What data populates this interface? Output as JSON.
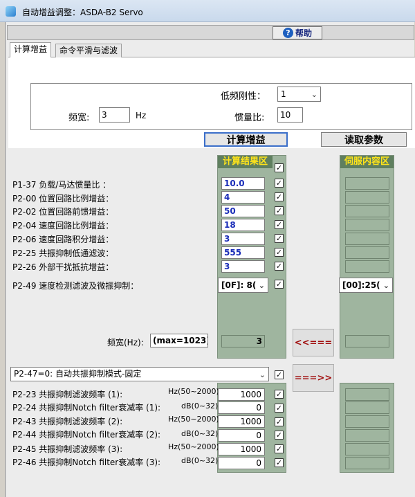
{
  "window": {
    "title": "自动增益调整：ASDA-B2 Servo"
  },
  "toolbar": {
    "help_label": "帮助",
    "help_icon": "?"
  },
  "tabs": [
    {
      "label": "计算增益",
      "active": true
    },
    {
      "label": "命令平滑与滤波",
      "active": false
    }
  ],
  "calc": {
    "stiffness_label": "低频刚性：",
    "stiffness_value": "1",
    "bandwidth_label": "频宽:",
    "bandwidth_value": "3",
    "bandwidth_unit": "Hz",
    "inertia_label": "惯量比:",
    "inertia_value": "10",
    "calc_button": "计算增益",
    "read_button": "读取参数"
  },
  "columns": {
    "calc_header": "计算结果区",
    "servo_header": "伺服内容区"
  },
  "params": [
    {
      "label": "P1-37 负载/马达惯量比 ：",
      "value": "10.0"
    },
    {
      "label": "P2-00 位置回路比例增益：",
      "value": "4"
    },
    {
      "label": "P2-02 位置回路前馈增益：",
      "value": "50"
    },
    {
      "label": "P2-04 速度回路比例增益：",
      "value": "18"
    },
    {
      "label": "P2-06 速度回路积分增益：",
      "value": "3"
    },
    {
      "label": "P2-25 共振抑制低通滤波：",
      "value": "555"
    },
    {
      "label": "P2-26 外部干扰抵抗增益：",
      "value": "3"
    }
  ],
  "p249": {
    "label": "P2-49 速度检测滤波及微振抑制：",
    "calc_value": "[0F]: 8(",
    "servo_value": "[00]:25("
  },
  "freq": {
    "label": "频宽(Hz):",
    "max_label": "(max=1023)",
    "value": "3"
  },
  "arrows": {
    "left": "<<===",
    "right": "===>>"
  },
  "p247": {
    "value": "P2-47=0: 自动共振抑制模式-固定"
  },
  "resonance": [
    {
      "label": "P2-23 共振抑制滤波频率 (1):",
      "unit": "Hz(50~2000)",
      "value": "1000"
    },
    {
      "label": "P2-24 共振抑制Notch filter衰减率 (1):",
      "unit": "dB(0~32)",
      "value": "0"
    },
    {
      "label": "P2-43 共振抑制滤波频率 (2):",
      "unit": "Hz(50~2000)",
      "value": "1000"
    },
    {
      "label": "P2-44 共振抑制Notch filter衰减率 (2):",
      "unit": "dB(0~32)",
      "value": "0"
    },
    {
      "label": "P2-45 共振抑制滤波频率 (3):",
      "unit": "Hz(50~2000)",
      "value": "1000"
    },
    {
      "label": "P2-46 共振抑制Notch filter衰减率 (3):",
      "unit": "dB(0~32)",
      "value": "0"
    }
  ],
  "colors": {
    "green": "#9fb59f",
    "header_bg": "#5f7f5f",
    "header_text": "#ffe41a",
    "value_text": "#1a2db8",
    "arrow": "#a10e0e"
  }
}
